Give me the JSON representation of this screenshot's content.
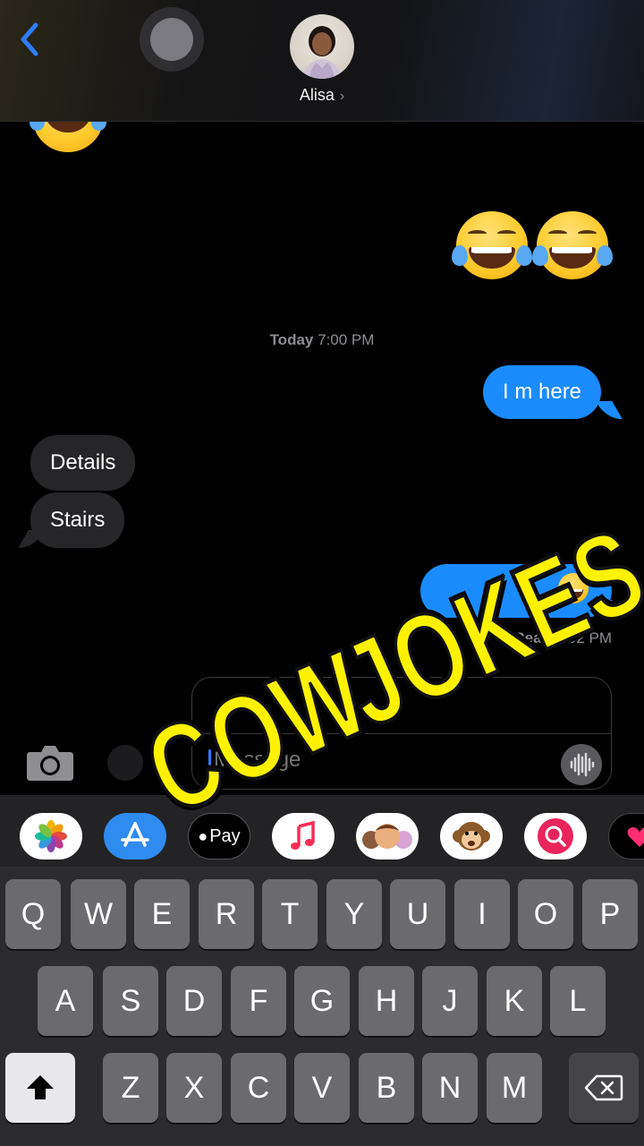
{
  "header": {
    "contact_name": "Alisa",
    "chevron": "›"
  },
  "timestamp": {
    "day": "Today",
    "time": "7:00 PM"
  },
  "messages": {
    "sent_1": "I m here",
    "received_1": "Details",
    "received_2": "Stairs"
  },
  "read_receipt": {
    "label": "Read",
    "time": "7:02 PM"
  },
  "sticker": {
    "text_1": "COW",
    "text_2": "JOKES"
  },
  "input": {
    "placeholder": "Message"
  },
  "apps": {
    "photos": "photos-app-icon",
    "appstore": "appstore-app-icon",
    "applepay_label": "Pay",
    "music": "music-app-icon",
    "memoji": "memoji-app-icon",
    "animoji": "animoji-app-icon",
    "search": "web-search-app-icon",
    "hearts": "digital-touch-app-icon"
  },
  "keyboard": {
    "row1": [
      "Q",
      "W",
      "E",
      "R",
      "T",
      "Y",
      "U",
      "I",
      "O",
      "P"
    ],
    "row2": [
      "A",
      "S",
      "D",
      "F",
      "G",
      "H",
      "J",
      "K",
      "L"
    ],
    "row3": [
      "Z",
      "X",
      "C",
      "V",
      "B",
      "N",
      "M"
    ]
  },
  "colors": {
    "sent_bubble": "#1a8cff",
    "received_bubble": "#262628",
    "sticker_yellow": "#fff200",
    "accent_blue": "#3478f6"
  }
}
